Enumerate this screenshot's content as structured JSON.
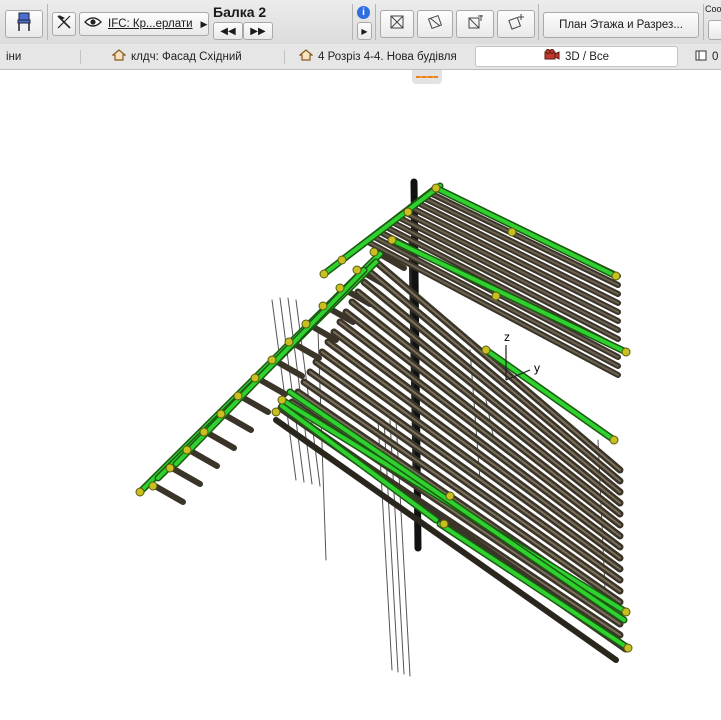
{
  "toolbar": {
    "layer_filter": "IFC: Кр...ерлати",
    "element_title": "Балка 2",
    "nav_prev": "◀◀",
    "nav_next": "▶▶",
    "info_symbol": "i",
    "view_button": "План Этажа и Разрез...",
    "right_label": "Coo"
  },
  "tabs": [
    {
      "label": "іни"
    },
    {
      "label": "клдч: Фасад Східний"
    },
    {
      "label": "4 Розріз 4-4. Нова будівля"
    },
    {
      "label": "3D / Все"
    },
    {
      "label": "0"
    }
  ],
  "axes": {
    "z": "z",
    "y": "y"
  },
  "icons": {
    "chair": "chair-icon",
    "select_arrow": "pointer-cross-icon",
    "eye": "eye-icon",
    "house": "house-icon",
    "camera": "camera-icon",
    "panel": "panel-icon"
  },
  "colors": {
    "selection_green": "#2fd12f",
    "beam_dark": "#3b3529",
    "node_yellow": "#c8c020",
    "handle_orange": "#f08020"
  }
}
